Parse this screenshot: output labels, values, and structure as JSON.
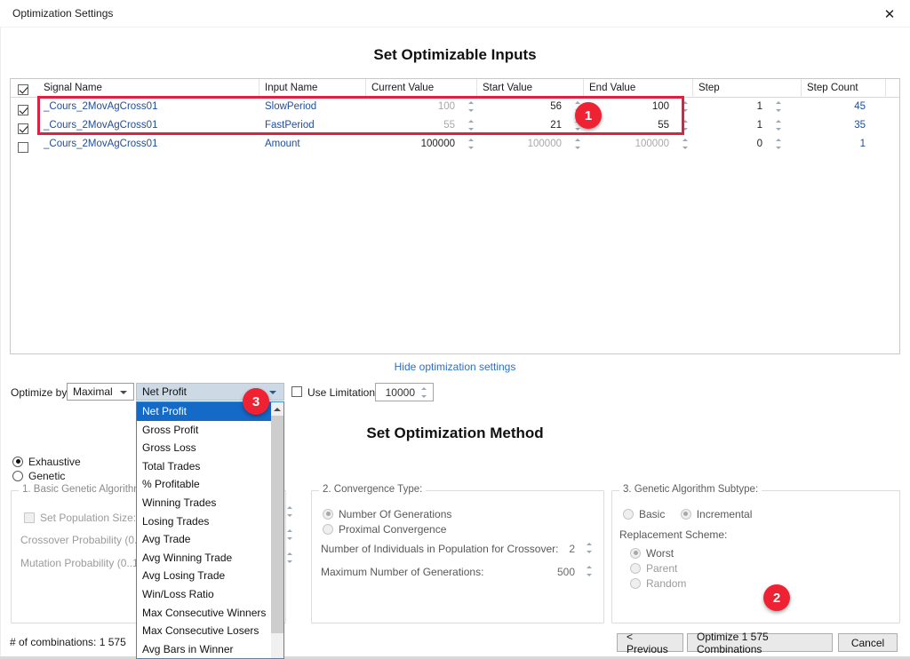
{
  "window": {
    "title": "Optimization Settings",
    "close_icon": "close-icon"
  },
  "headings": {
    "inputs": "Set Optimizable Inputs",
    "method": "Set Optimization Method"
  },
  "grid": {
    "columns": [
      "Signal Name",
      "Input Name",
      "Current Value",
      "Start Value",
      "End Value",
      "Step",
      "Step Count"
    ],
    "header_checkbox_checked": true,
    "rows": [
      {
        "checked": true,
        "signal_name": "_Cours_2MovAgCross01",
        "input_name": "SlowPeriod",
        "current_value": "100",
        "start_value": "56",
        "end_value": "100",
        "step": "1",
        "step_count": "45"
      },
      {
        "checked": true,
        "signal_name": "_Cours_2MovAgCross01",
        "input_name": "FastPeriod",
        "current_value": "55",
        "start_value": "21",
        "end_value": "55",
        "step": "1",
        "step_count": "35"
      },
      {
        "checked": false,
        "signal_name": "_Cours_2MovAgCross01",
        "input_name": "Amount",
        "current_value": "100000",
        "start_value": "100000",
        "end_value": "100000",
        "step": "0",
        "step_count": "1"
      }
    ]
  },
  "hide_link": "Hide optimization settings",
  "optimize_by": {
    "label": "Optimize by:",
    "direction_value": "Maximal",
    "criterion_value": "Net Profit",
    "criterion_options": [
      "Net Profit",
      "Gross Profit",
      "Gross Loss",
      "Total Trades",
      "% Profitable",
      "Winning Trades",
      "Losing Trades",
      "Avg Trade",
      "Avg Winning Trade",
      "Avg Losing Trade",
      "Win/Loss Ratio",
      "Max Consecutive Winners",
      "Max Consecutive Losers",
      "Avg Bars in Winner"
    ],
    "selected_index": 0
  },
  "use_limitation": {
    "label": "Use Limitation",
    "checked": false,
    "value": "10000"
  },
  "method": {
    "exhaustive_label": "Exhaustive",
    "genetic_label": "Genetic",
    "selected": "Exhaustive"
  },
  "group1": {
    "legend": "1. Basic Genetic Algorithm",
    "set_population_label": "Set Population Size:",
    "set_population_checked": false,
    "info_icon": "info-icon",
    "crossover_label": "Crossover Probability (0..1]:",
    "mutation_label": "Mutation Probability (0..1]:"
  },
  "group2": {
    "legend": "2. Convergence Type:",
    "opt_generations": "Number Of Generations",
    "opt_proximal": "Proximal Convergence",
    "selected": "Number Of Generations",
    "individuals_label": "Number of Individuals in Population for Crossover:",
    "individuals_value": "2",
    "max_generations_label": "Maximum Number of Generations:",
    "max_generations_value": "500"
  },
  "group3": {
    "legend": "3. Genetic Algorithm Subtype:",
    "basic_label": "Basic",
    "incremental_label": "Incremental",
    "subtype_selected": "Incremental",
    "replacement_label": "Replacement Scheme:",
    "replacement_options": [
      "Worst",
      "Parent",
      "Random"
    ],
    "replacement_selected": "Worst"
  },
  "footer": {
    "combinations": "# of combinations: 1 575",
    "previous_button": "< Previous",
    "optimize_button": "Optimize 1 575 Combinations",
    "cancel_button": "Cancel"
  },
  "annotations": [
    {
      "id": "1",
      "label": "1"
    },
    {
      "id": "2",
      "label": "2"
    },
    {
      "id": "3",
      "label": "3"
    }
  ],
  "colors": {
    "accent_red": "#ee2233",
    "link_blue": "#2a6fc9",
    "selection_blue": "#1569c7",
    "grid_text_blue": "#1f4e9c"
  }
}
